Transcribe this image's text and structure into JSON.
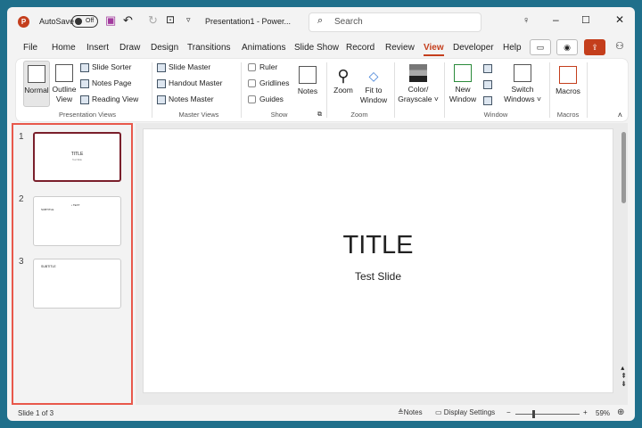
{
  "titlebar": {
    "logo": "P",
    "autosave": "AutoSave",
    "autosave_state": "Off",
    "doc_title": "Presentation1  -  Power...",
    "search_placeholder": "Search"
  },
  "tabs": [
    "File",
    "Home",
    "Insert",
    "Draw",
    "Design",
    "Transitions",
    "Animations",
    "Slide Show",
    "Record",
    "Review",
    "View",
    "Developer",
    "Help"
  ],
  "ribbon": {
    "presentation_views": {
      "label": "Presentation Views",
      "normal": "Normal",
      "outline": "Outline View",
      "slide_sorter": "Slide Sorter",
      "notes_page": "Notes Page",
      "reading_view": "Reading View"
    },
    "master_views": {
      "label": "Master Views",
      "slide_master": "Slide Master",
      "handout_master": "Handout Master",
      "notes_master": "Notes Master"
    },
    "show": {
      "label": "Show",
      "ruler": "Ruler",
      "gridlines": "Gridlines",
      "guides": "Guides",
      "notes": "Notes"
    },
    "zoom": {
      "label": "Zoom",
      "zoom": "Zoom",
      "fit": "Fit to Window"
    },
    "color": {
      "label": "Color/ Grayscale"
    },
    "window": {
      "label": "Window",
      "new_window": "New Window",
      "switch": "Switch Windows"
    },
    "macros": {
      "label": "Macros",
      "macros": "Macros"
    }
  },
  "slides": [
    {
      "num": "1",
      "title": "TITLE",
      "sub": "Test Slide"
    },
    {
      "num": "2",
      "title": "SUBTITLE",
      "sub": "• TEXT"
    },
    {
      "num": "3",
      "title": "SUBTITLE"
    }
  ],
  "main_slide": {
    "title": "TITLE",
    "subtitle": "Test Slide"
  },
  "status": {
    "slide_info": "Slide 1 of 3",
    "notes": "Notes",
    "display": "Display Settings",
    "zoom": "59%",
    "zoom_value": 59
  }
}
